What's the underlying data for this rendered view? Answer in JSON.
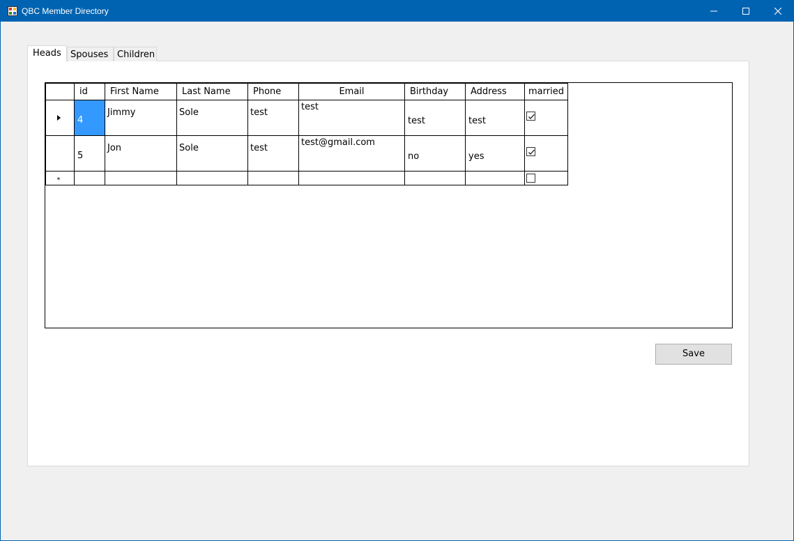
{
  "window": {
    "title": "QBC Member Directory"
  },
  "tabs": [
    {
      "label": "Heads",
      "active": true
    },
    {
      "label": "Spouses",
      "active": false
    },
    {
      "label": "Children",
      "active": false
    }
  ],
  "grid": {
    "columns": [
      "id",
      "First Name",
      "Last Name",
      "Phone",
      "Email",
      "Birthday",
      "Address",
      "married"
    ],
    "rows": [
      {
        "id": "4",
        "first_name": "Jimmy",
        "last_name": "Sole",
        "phone": "test",
        "email": "test",
        "birthday": "test",
        "address": "test",
        "married": true,
        "current": true
      },
      {
        "id": "5",
        "first_name": "Jon",
        "last_name": "Sole",
        "phone": "test",
        "email": "test@gmail.com",
        "birthday": "no",
        "address": "yes",
        "married": true,
        "current": false
      }
    ],
    "new_row_marker": "*",
    "selection_color": "#3399ff"
  },
  "buttons": {
    "save_label": "Save"
  },
  "colors": {
    "titlebar": "#0063b1",
    "background": "#f0f0f0"
  }
}
